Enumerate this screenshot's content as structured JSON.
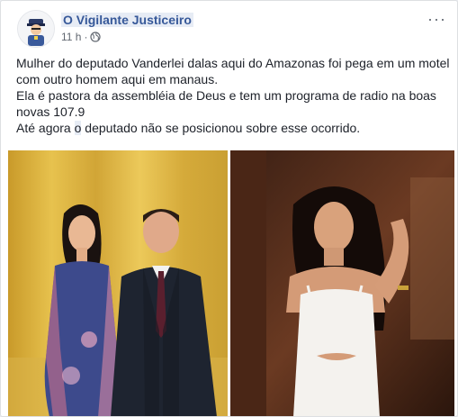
{
  "post": {
    "author": "O Vigilante Justiceiro",
    "time": "11 h",
    "separator": "·",
    "privacy_icon": "globe-icon",
    "more_label": "···",
    "text": {
      "line1": "Mulher do deputado Vanderlei dalas aqui do Amazonas foi pega em um motel com outro homem aqui em manaus.",
      "line2": "Ela é pastora da assembléia de Deus e tem um programa de radio na boas novas 107.9",
      "line3_a": "Até agora ",
      "line3_link": "o",
      "line3_b": " deputado não se posicionou sobre esse ocorrido."
    },
    "photos": [
      {
        "description_icon": "couple-photo"
      },
      {
        "description_icon": "woman-white-dress-photo"
      }
    ]
  },
  "colors": {
    "link": "#365899",
    "text": "#1d2129",
    "meta": "#616770"
  }
}
